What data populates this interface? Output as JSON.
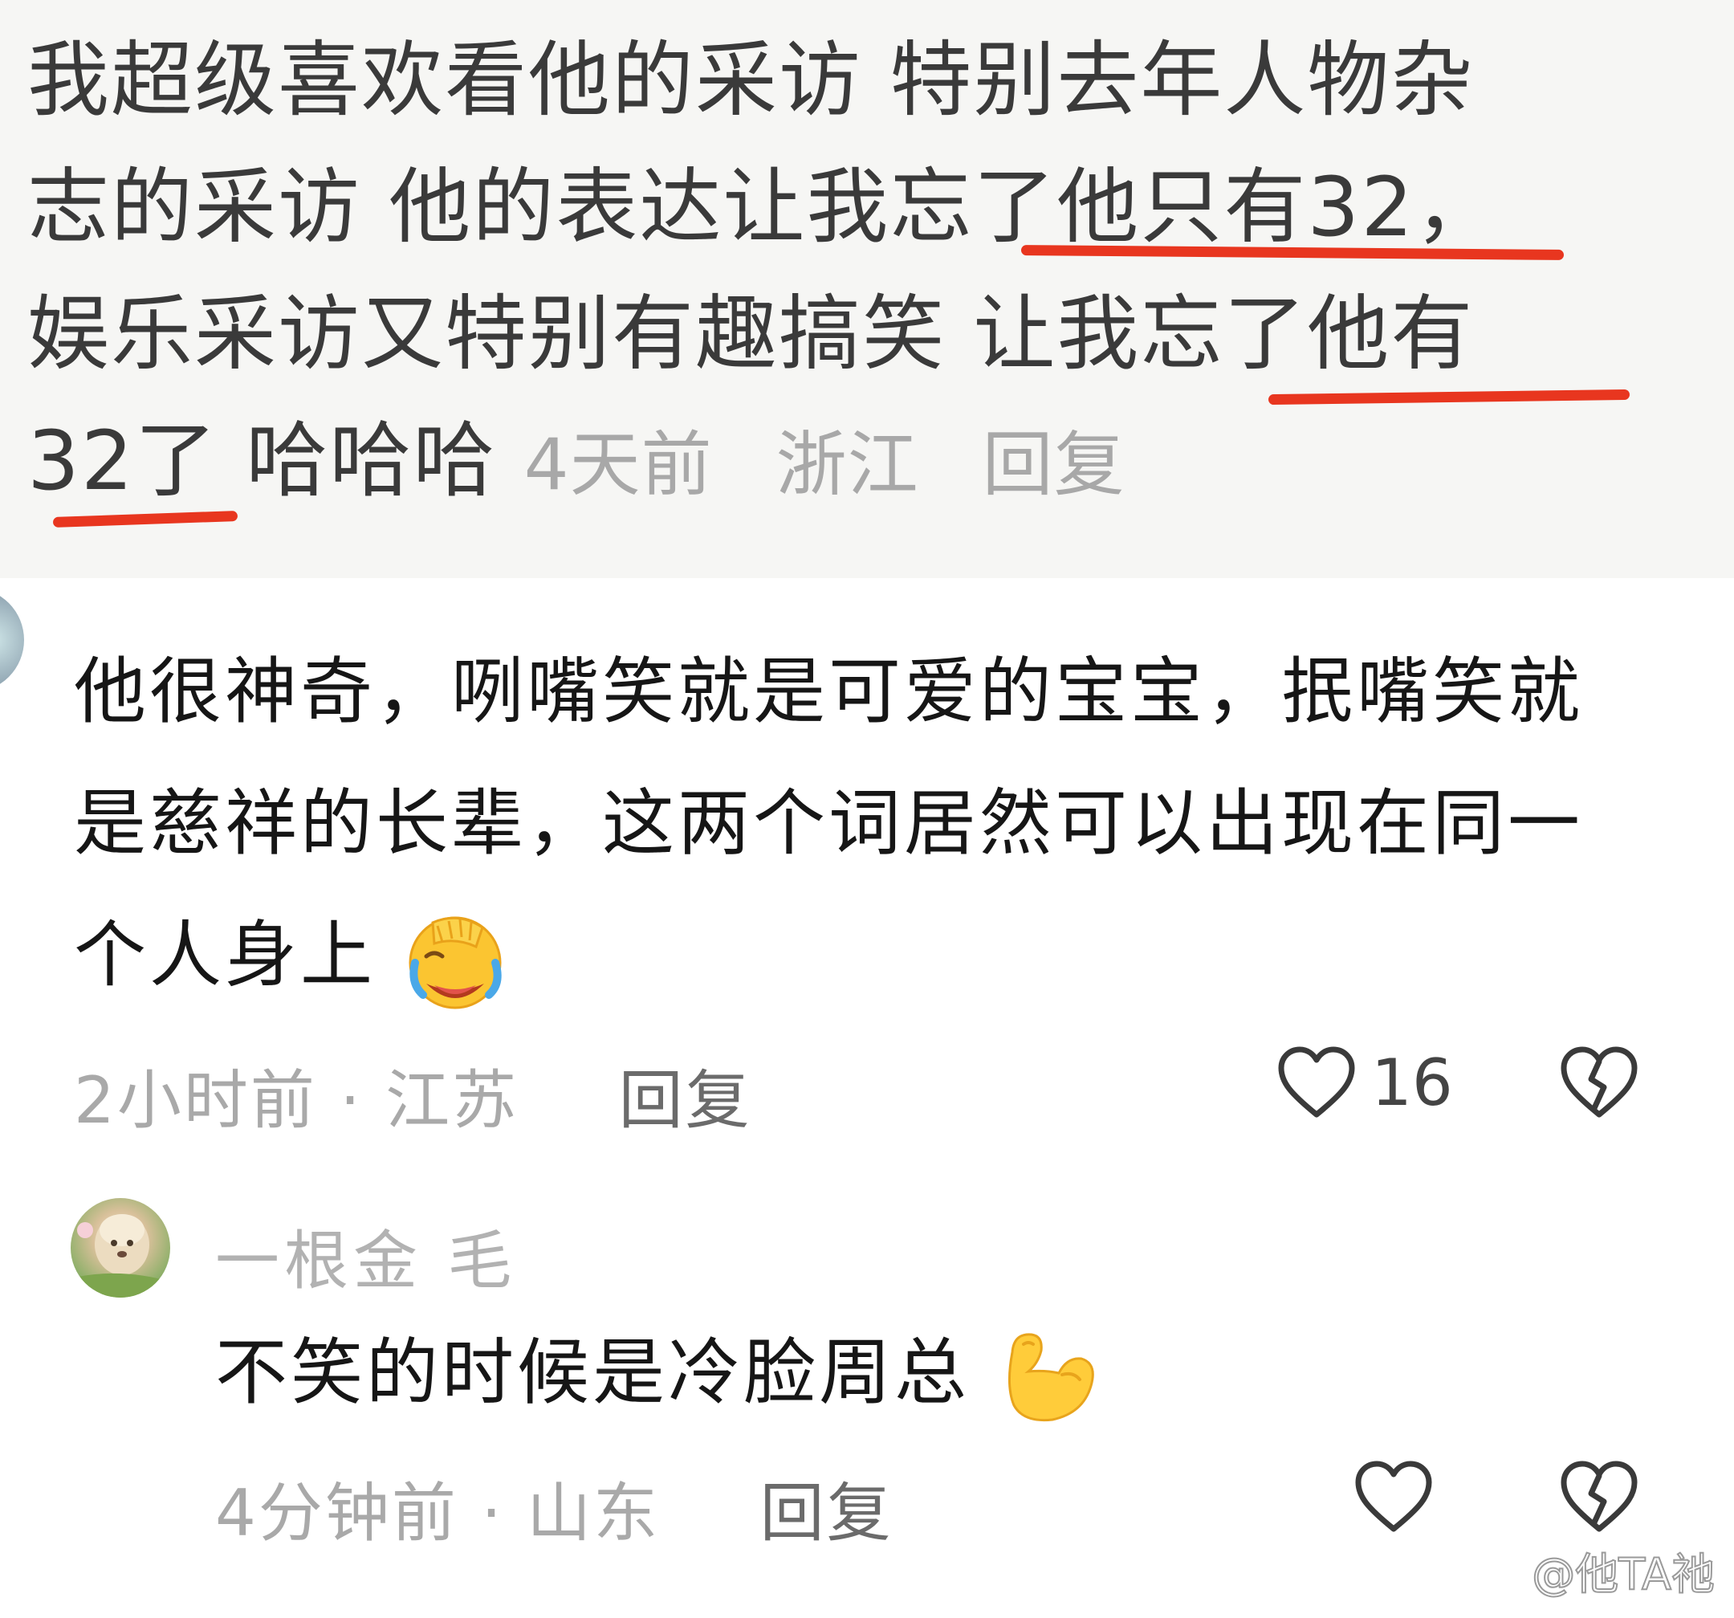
{
  "comment1": {
    "line1": "我超级喜欢看他的采访 特别去年人物杂",
    "line2": "志的采访 他的表达让我忘了他只有32，",
    "line3": "娱乐采访又特别有趣搞笑 让我忘了他有",
    "line4": "32了 哈哈哈",
    "time": "4天前",
    "location": "浙江",
    "reply": "回复",
    "underline_color": "#e8361f"
  },
  "comment2": {
    "line1": "他很神奇，咧嘴笑就是可爱的宝宝，抿嘴笑就",
    "line2": "是慈祥的长辈，这两个词居然可以出现在同一",
    "line3": "个人身上",
    "emoji": "face-palm-laughing-emoji",
    "meta": "2小时前 · 江苏",
    "reply": "回复",
    "likes": "16"
  },
  "comment3": {
    "username": "一根金 毛",
    "text": "不笑的时候是冷脸周总",
    "emoji": "flexed-biceps-emoji",
    "meta": "4分钟前 · 山东",
    "reply": "回复"
  },
  "watermark": "@他TA祂"
}
